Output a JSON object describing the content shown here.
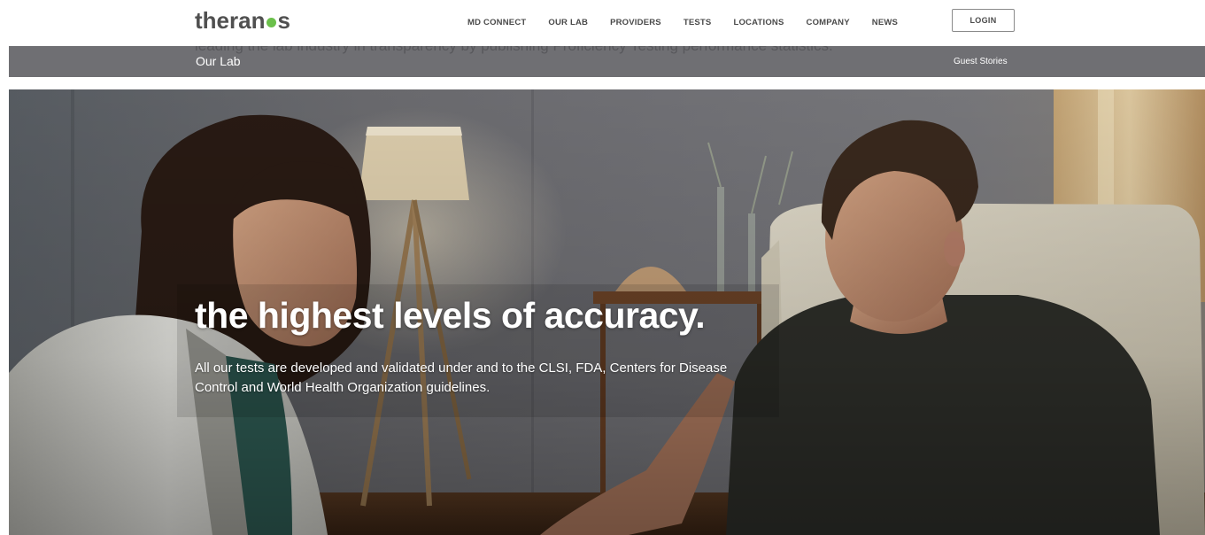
{
  "brand": {
    "name_part1": "theran",
    "name_part2": "s",
    "logo_dot_color": "#6bc04b"
  },
  "nav": {
    "items": [
      {
        "label": "MD CONNECT"
      },
      {
        "label": "OUR LAB"
      },
      {
        "label": "PROVIDERS"
      },
      {
        "label": "TESTS"
      },
      {
        "label": "LOCATIONS"
      },
      {
        "label": "COMPANY"
      },
      {
        "label": "NEWS"
      }
    ],
    "login_label": "LOGIN"
  },
  "subbar": {
    "ghost_text": "leading the lab industry in transparency by publishing Proficiency Testing performance statistics.",
    "title": "Our Lab",
    "link_label": "Guest Stories",
    "background_color": "#6f6f73"
  },
  "hero": {
    "headline": "the highest levels of accuracy.",
    "subtext": "All our tests are developed and validated under and to the CLSI, FDA, Centers for Disease Control and World Health Organization guidelines."
  }
}
